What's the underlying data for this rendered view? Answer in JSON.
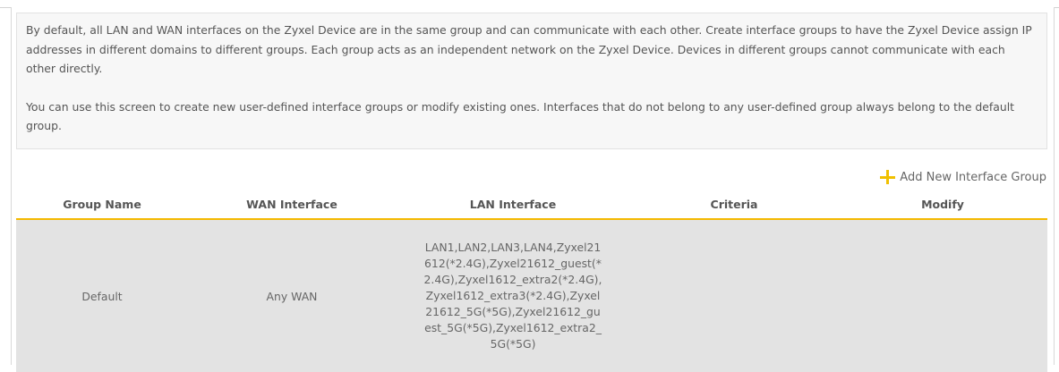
{
  "description": {
    "paragraph1": "By default, all LAN and WAN interfaces on the Zyxel Device are in the same group and can communicate with each other. Create interface groups to have the Zyxel Device assign IP addresses in different domains to different groups. Each group acts as an independent network on the Zyxel Device. Devices in different groups cannot communicate with each other directly.",
    "paragraph2": "You can use this screen to create new user-defined interface groups or modify existing ones. Interfaces that do not belong to any user-defined group always belong to the default group."
  },
  "toolbar": {
    "add_label": "Add New Interface Group",
    "add_icon": "plus-icon"
  },
  "table": {
    "columns": [
      "Group Name",
      "WAN Interface",
      "LAN Interface",
      "Criteria",
      "Modify"
    ],
    "rows": [
      {
        "group_name": "Default",
        "wan_interface": "Any WAN",
        "lan_interface": "LAN1,LAN2,LAN3,LAN4,Zyxel21612(*2.4G),Zyxel21612_guest(*2.4G),Zyxel1612_extra2(*2.4G),Zyxel1612_extra3(*2.4G),Zyxel21612_5G(*5G),Zyxel21612_guest_5G(*5G),Zyxel1612_extra2_5G(*5G)",
        "criteria": "",
        "modify": ""
      }
    ]
  },
  "colors": {
    "accent": "#f4b800",
    "row_bg": "#e3e3e3",
    "desc_bg": "#f7f7f7"
  }
}
